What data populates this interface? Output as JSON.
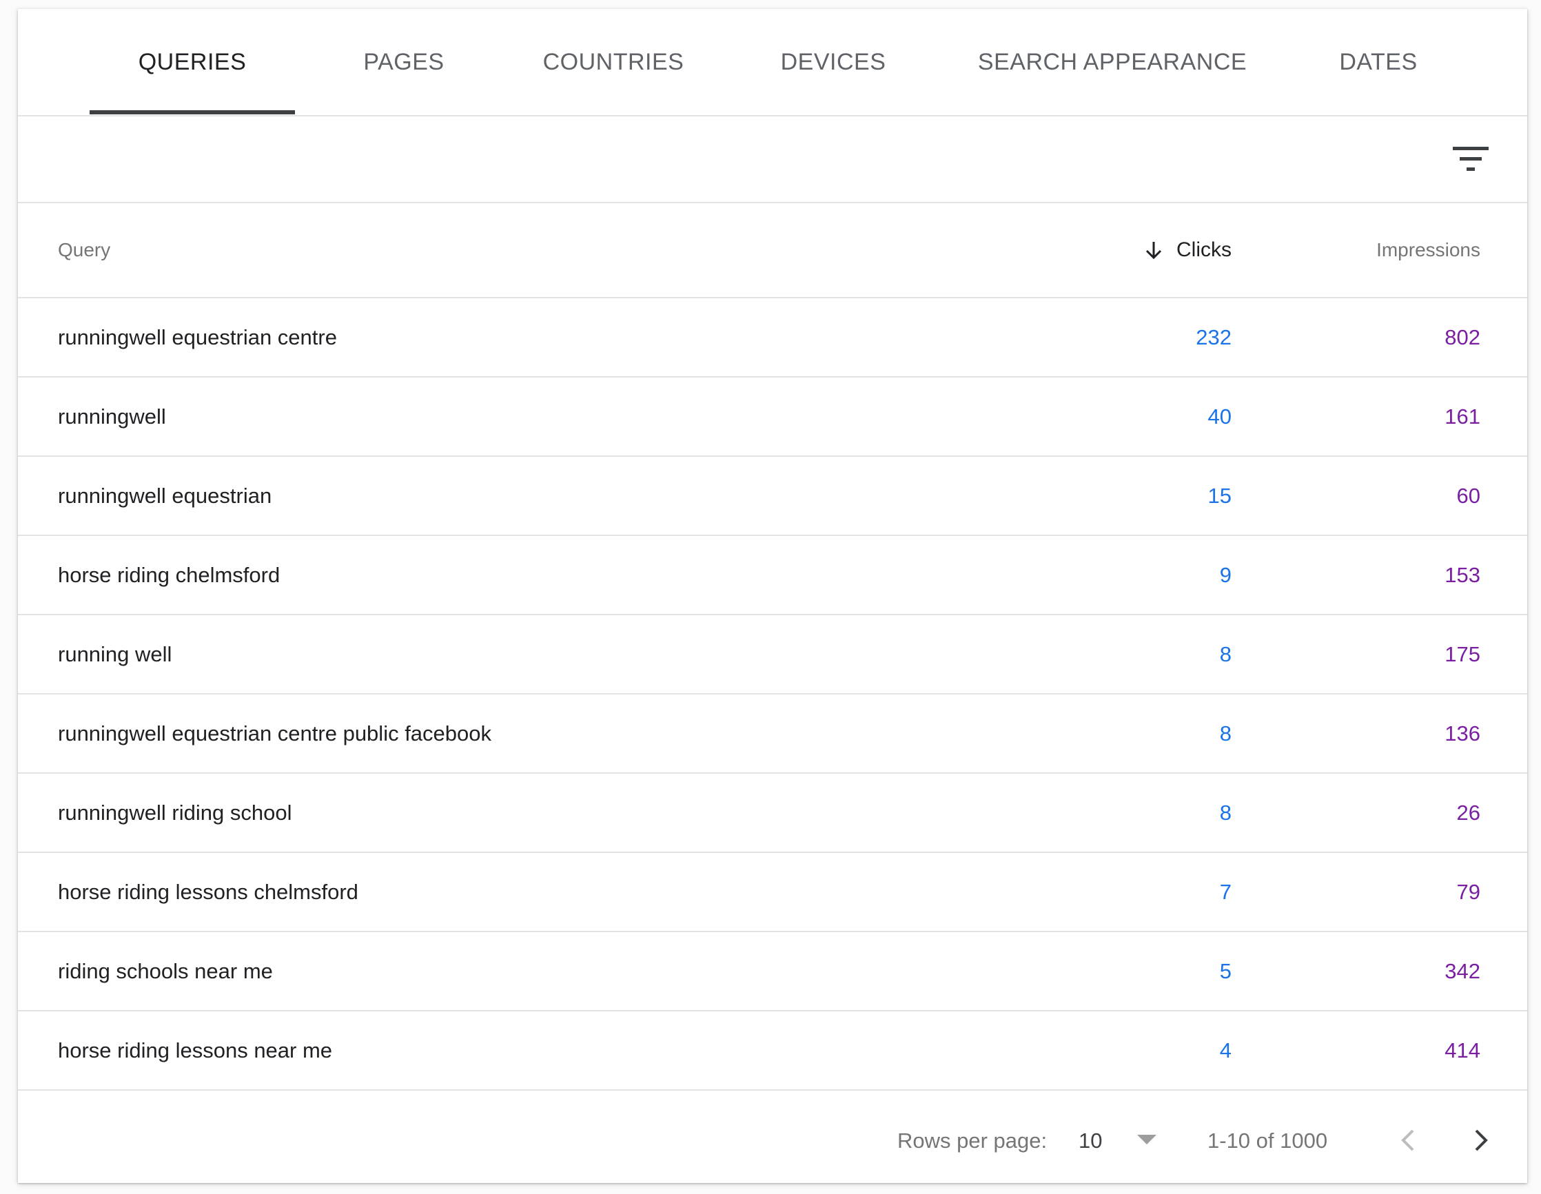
{
  "tabs": [
    {
      "label": "QUERIES",
      "active": true
    },
    {
      "label": "PAGES",
      "active": false
    },
    {
      "label": "COUNTRIES",
      "active": false
    },
    {
      "label": "DEVICES",
      "active": false
    },
    {
      "label": "SEARCH APPEARANCE",
      "active": false
    },
    {
      "label": "DATES",
      "active": false
    }
  ],
  "toolbar": {
    "filter_icon": "filter-list-icon"
  },
  "table": {
    "headers": {
      "query": "Query",
      "clicks": "Clicks",
      "impressions": "Impressions"
    },
    "sort_icon": "arrow-downward-icon",
    "rows": [
      {
        "query": "runningwell equestrian centre",
        "clicks": "232",
        "impressions": "802"
      },
      {
        "query": "runningwell",
        "clicks": "40",
        "impressions": "161"
      },
      {
        "query": "runningwell equestrian",
        "clicks": "15",
        "impressions": "60"
      },
      {
        "query": "horse riding chelmsford",
        "clicks": "9",
        "impressions": "153"
      },
      {
        "query": "running well",
        "clicks": "8",
        "impressions": "175"
      },
      {
        "query": "runningwell equestrian centre public facebook",
        "clicks": "8",
        "impressions": "136"
      },
      {
        "query": "runningwell riding school",
        "clicks": "8",
        "impressions": "26"
      },
      {
        "query": "horse riding lessons chelmsford",
        "clicks": "7",
        "impressions": "79"
      },
      {
        "query": "riding schools near me",
        "clicks": "5",
        "impressions": "342"
      },
      {
        "query": "horse riding lessons near me",
        "clicks": "4",
        "impressions": "414"
      }
    ]
  },
  "pagination": {
    "rows_per_page_label": "Rows per page:",
    "rows_per_page_value": "10",
    "range": "1-10 of 1000"
  },
  "colors": {
    "clicks": "#1a73e8",
    "impressions": "#7b1fa2",
    "tab_indicator": "#3c4043"
  }
}
